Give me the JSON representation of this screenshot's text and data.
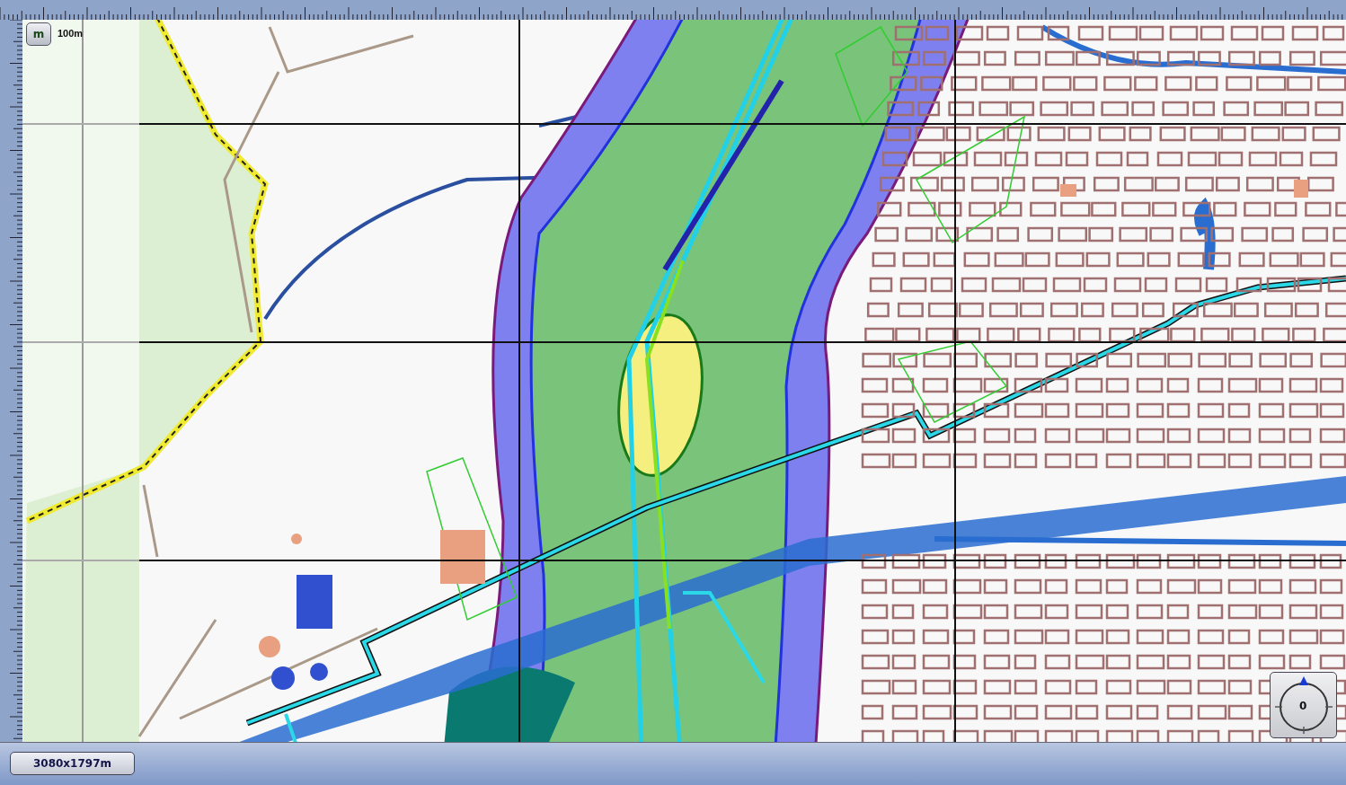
{
  "unit_button": {
    "label": "m"
  },
  "scale_label": "100m",
  "extent_button": {
    "label": "3080x1797m"
  },
  "compass": {
    "heading": "0"
  }
}
